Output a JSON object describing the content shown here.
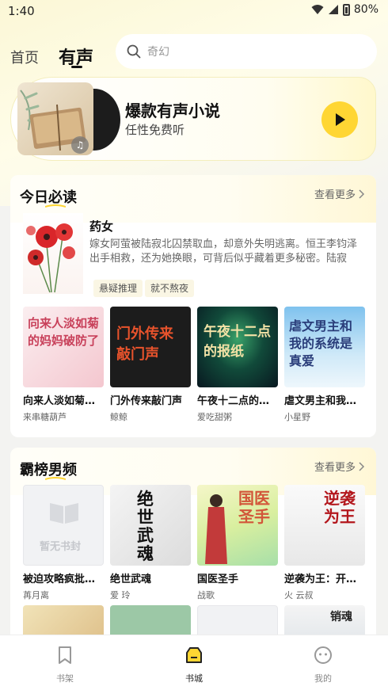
{
  "status_bar": {
    "time": "1:40",
    "battery": "80%"
  },
  "header": {
    "tabs": [
      {
        "label": "首页"
      },
      {
        "label": "有声"
      }
    ],
    "search": {
      "placeholder": "奇幻"
    }
  },
  "banner": {
    "title": "爆款有声小说",
    "subtitle": "任性免费听"
  },
  "today": {
    "title": "今日必读",
    "see_more": "查看更多",
    "featured": {
      "title": "药女",
      "description": "嫁女阿萤被陆寂北囚禁取血，却意外失明逃离。恒王李钧泽出手相救，还为她换眼，可背后似乎藏着更多秘密。陆寂北...",
      "tags": [
        "悬疑推理",
        "就不熬夜"
      ]
    },
    "books": [
      {
        "title": "向来人淡如菊的...",
        "author": "来串糖葫芦",
        "cover_text": "向来人淡如菊的妈妈破防了"
      },
      {
        "title": "门外传来敲门声",
        "author": "鲸鲸",
        "cover_text": "门外传来敲门声"
      },
      {
        "title": "午夜十二点的报...",
        "author": "爱吃甜粥",
        "cover_text": "午夜十二点的报纸"
      },
      {
        "title": "虐文男主和我的...",
        "author": "小星野",
        "cover_text": "虐文男主和我的系统是真爱"
      }
    ]
  },
  "ranking": {
    "title": "霸榜男频",
    "see_more": "查看更多",
    "books": [
      {
        "title": "被迫攻略疯批魔...",
        "author": "苒月离",
        "cover_text": "暂无书封"
      },
      {
        "title": "绝世武魂",
        "author": "爱 玲",
        "cover_text": "绝世武魂"
      },
      {
        "title": "国医圣手",
        "author": "战歌",
        "cover_text": "国医圣手"
      },
      {
        "title": "逆袭为王：开局...",
        "author": "火 云叔",
        "cover_text": "逆袭为王"
      }
    ],
    "more_covers": [
      "",
      "",
      "",
      "销魂"
    ]
  },
  "bottom_nav": [
    {
      "label": "书架",
      "icon": "bookmark-icon"
    },
    {
      "label": "书城",
      "icon": "bookstore-icon"
    },
    {
      "label": "我的",
      "icon": "profile-icon"
    }
  ],
  "colors": {
    "accent": "#ffd633",
    "text": "#111111",
    "muted": "#666666"
  }
}
